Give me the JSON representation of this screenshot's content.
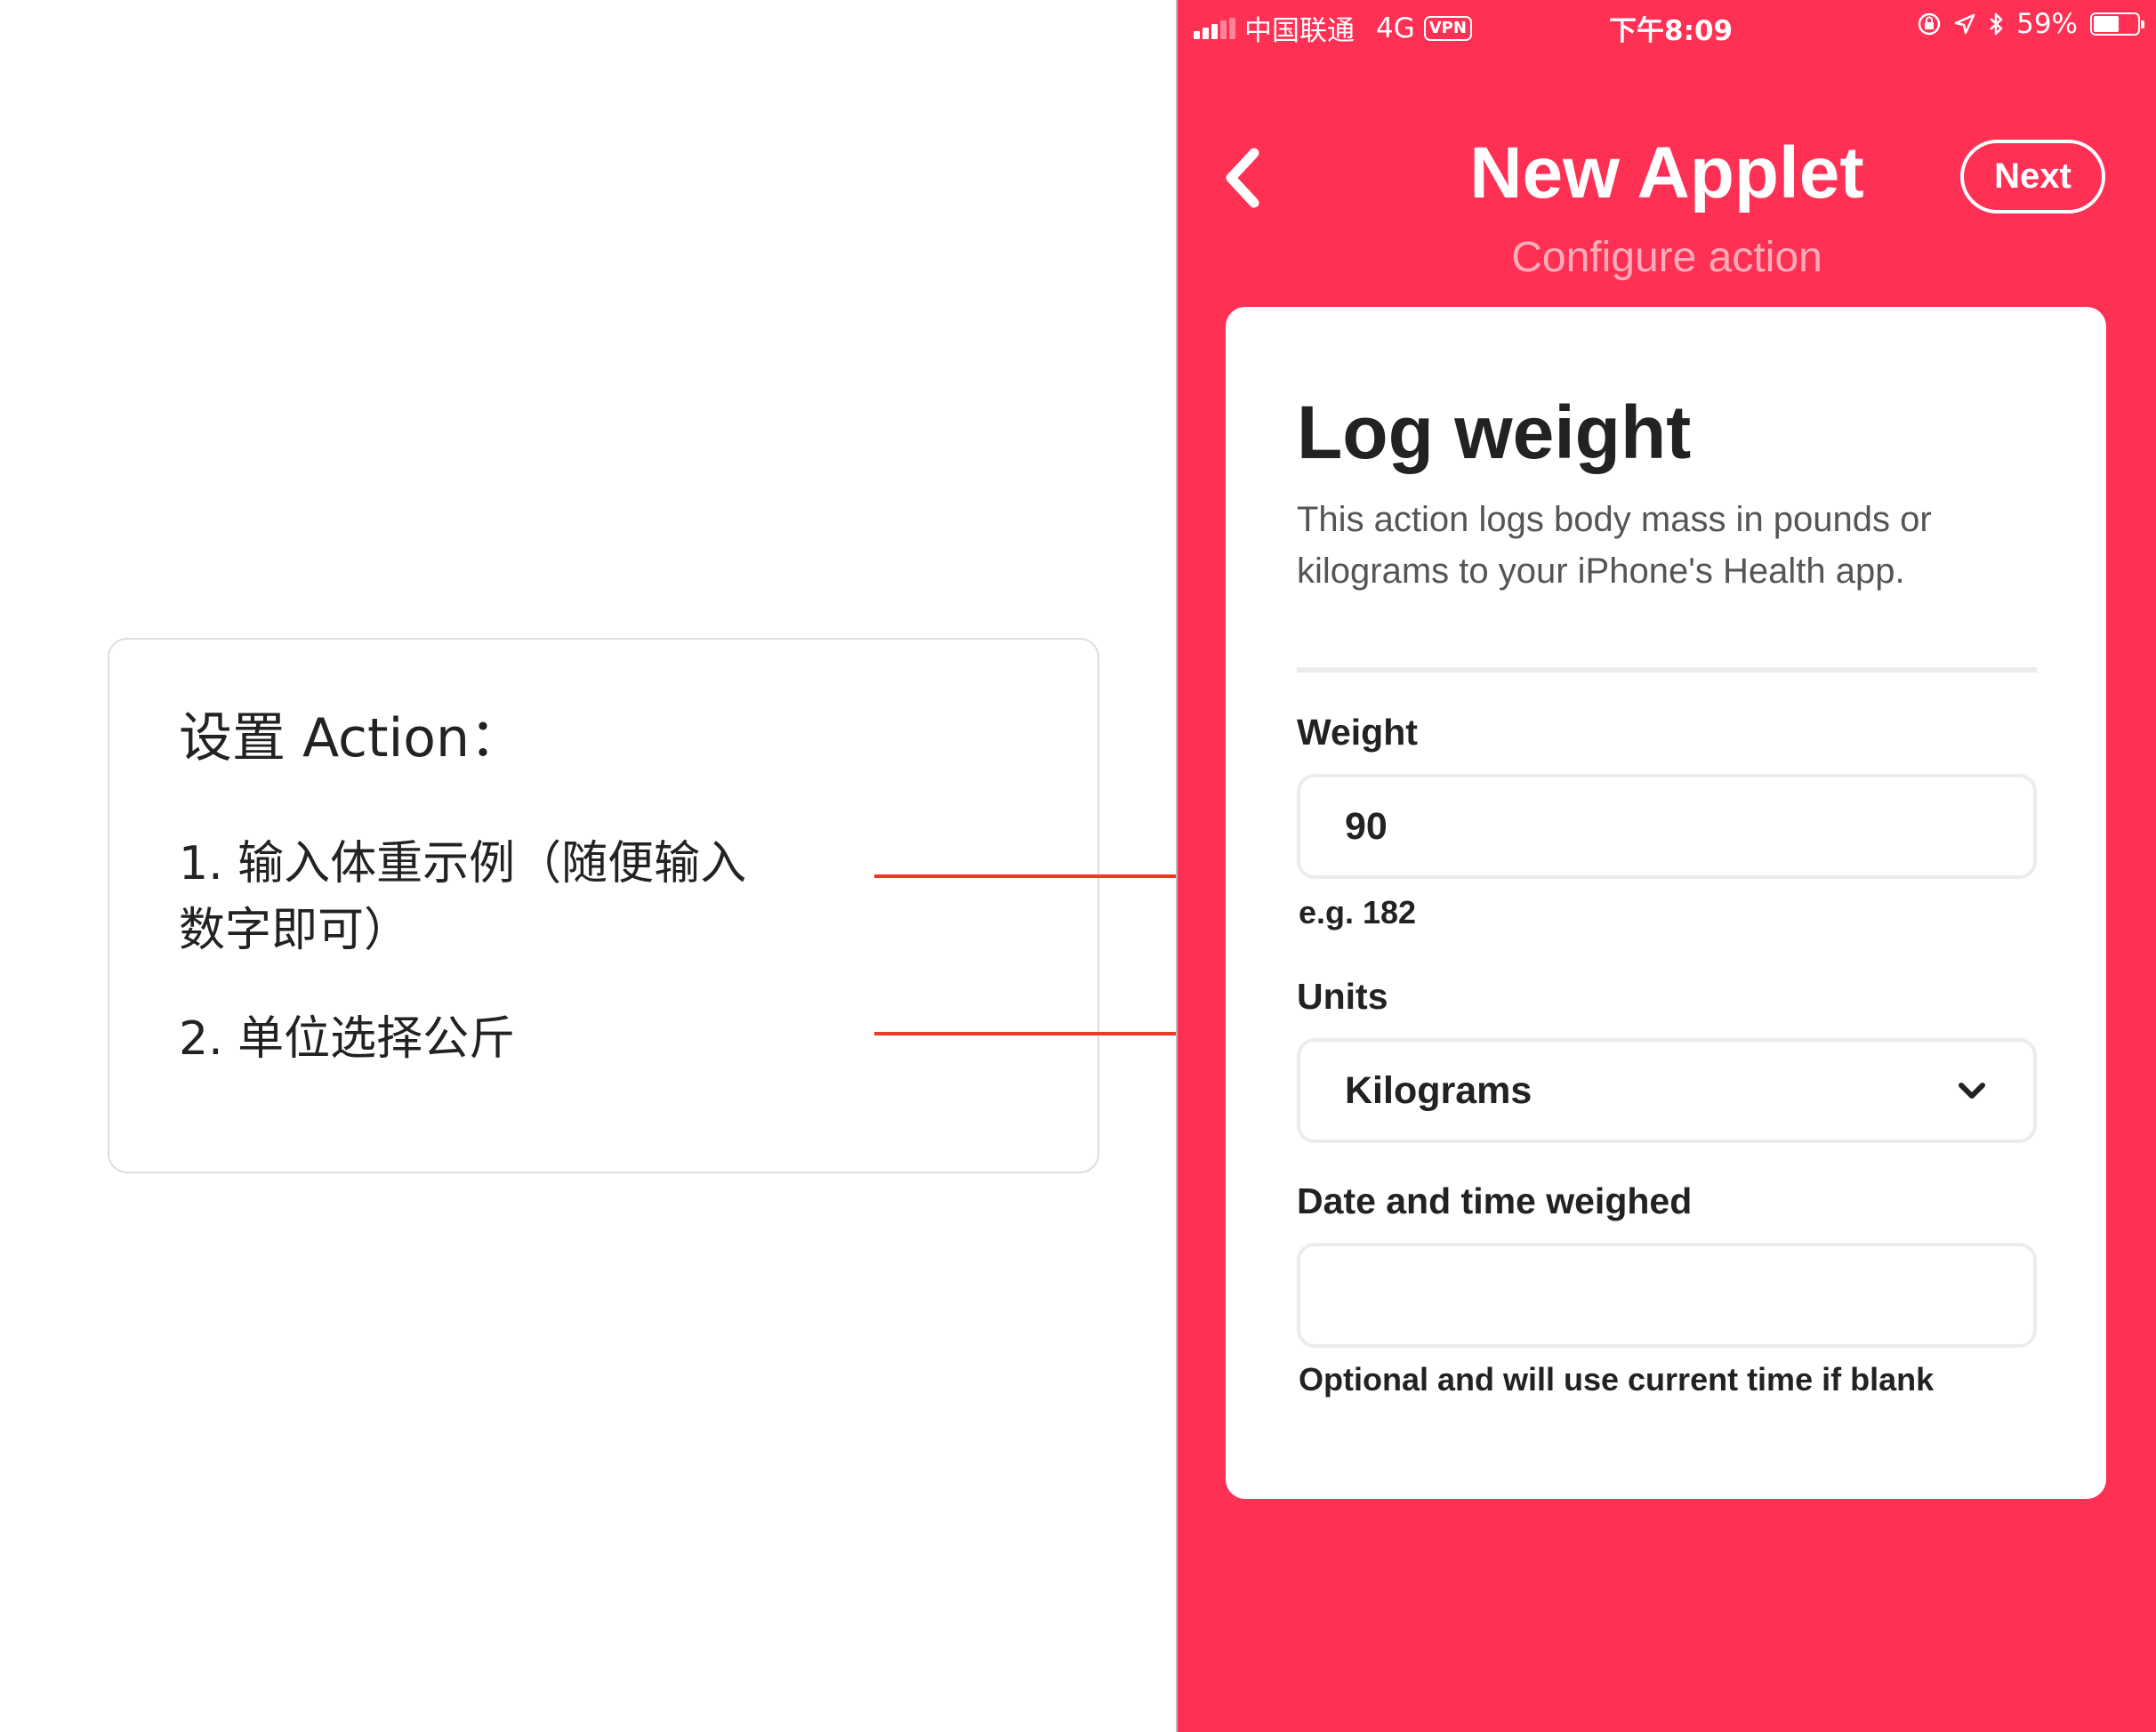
{
  "annotation": {
    "title": "设置 Action：",
    "step1_line1": "1. 输入体重示例（随便输入",
    "step1_line2": "数字即可）",
    "step2": "2. 单位选择公斤"
  },
  "status_bar": {
    "carrier": "中国联通",
    "network": "4G",
    "vpn": "VPN",
    "time": "下午8:09",
    "battery": "59%",
    "battery_level": 0.59
  },
  "nav": {
    "back_icon": "chevron-left-icon",
    "title": "New Applet",
    "subtitle": "Configure action",
    "next_label": "Next"
  },
  "card": {
    "title": "Log weight",
    "description": "This action logs body mass in pounds or kilograms to your iPhone's Health app.",
    "weight": {
      "label": "Weight",
      "value": "90",
      "hint": "e.g. 182"
    },
    "units": {
      "label": "Units",
      "value": "Kilograms",
      "icon": "chevron-down-icon"
    },
    "date": {
      "label": "Date and time weighed",
      "value": "",
      "hint": "Optional and will use current time if blank"
    }
  },
  "colors": {
    "brand": "#fe3054",
    "connector": "#ee3a24"
  }
}
